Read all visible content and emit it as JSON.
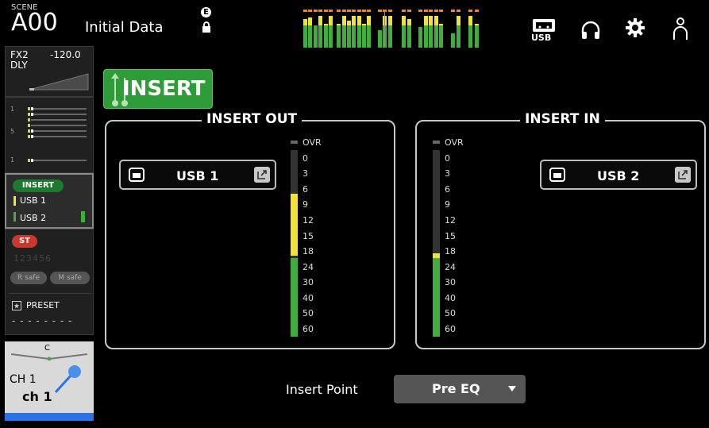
{
  "header": {
    "scene_label": "SCENE",
    "scene_number": "A00",
    "scene_title": "Initial Data",
    "e_badge": "E",
    "icons": [
      "usb-icon",
      "headphones-icon",
      "gear-icon",
      "user-icon"
    ],
    "usb_label": "USB"
  },
  "strip": {
    "fx_label": "FX2",
    "fx_value": "-120.0",
    "fx_sub": "DLY",
    "insert_badge": "INSERT",
    "insert_out": "USB 1",
    "insert_in": "USB 2",
    "st_badge": "ST",
    "scene_digits": "123456",
    "r_safe": "R safe",
    "m_safe": "M safe",
    "preset_label": "PRESET",
    "preset_value": "- - - - - - - -",
    "pan_center": "C",
    "channel_id": "CH 1",
    "channel_name": "ch 1"
  },
  "main": {
    "insert_button": "INSERT",
    "insert_out_title": "INSERT OUT",
    "insert_in_title": "INSERT IN",
    "insert_out_port": "USB 1",
    "insert_in_port": "USB 2",
    "meter_scale": [
      "OVR",
      "0",
      "3",
      "6",
      "9",
      "12",
      "15",
      "18",
      "24",
      "30",
      "40",
      "50",
      "60"
    ],
    "insert_out_meter_level": "6",
    "insert_in_meter_level": "18",
    "insert_point_label": "Insert Point",
    "insert_point_value": "Pre EQ"
  },
  "colors": {
    "meter_green": "#3fae3a",
    "meter_yellow": "#f0e23a",
    "meter_orange": "#e88a20",
    "insert_green": "#2f9c3a",
    "st_red": "#c8382c",
    "channel_blue": "#2a72e6"
  }
}
